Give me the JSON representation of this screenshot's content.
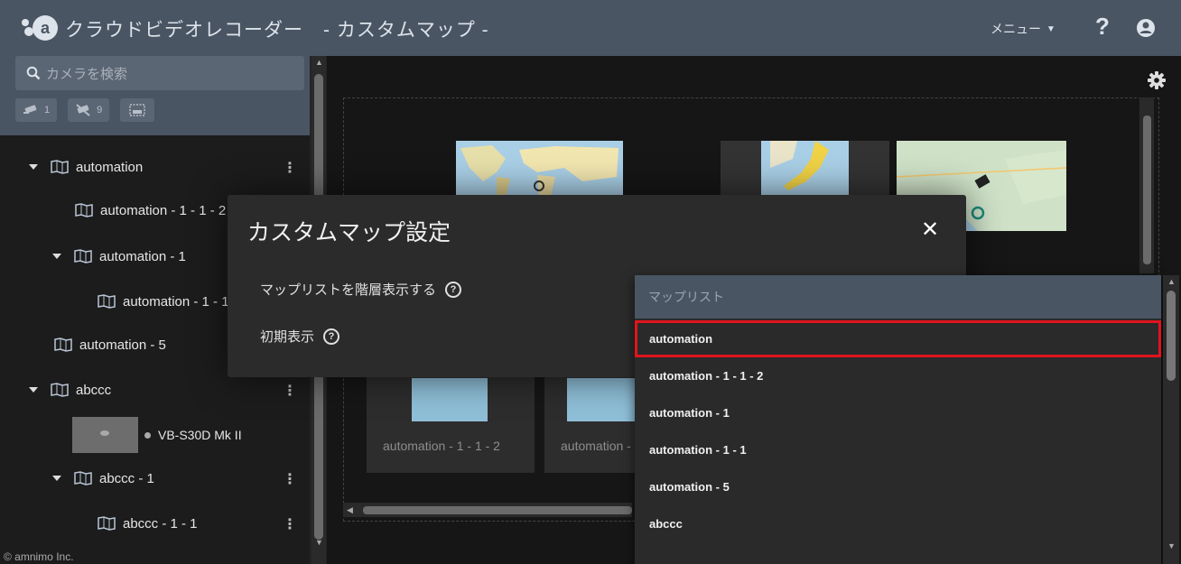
{
  "header": {
    "app_title": "クラウドビデオレコーダー　- カスタムマップ -",
    "menu_label": "メニュー",
    "help_label": "?"
  },
  "sidebar": {
    "search_placeholder": "カメラを検索",
    "filters": {
      "online_count": "1",
      "offline_count": "9"
    },
    "tree": [
      {
        "label": "automation",
        "level": 0,
        "expanded": true
      },
      {
        "label": "automation - 1 - 1 - 2",
        "level": 1
      },
      {
        "label": "automation - 1",
        "level": 1,
        "expanded": true
      },
      {
        "label": "automation - 1 - 1",
        "level": 2
      },
      {
        "label": "automation - 5",
        "level": 0
      },
      {
        "label": "abccc",
        "level": 0,
        "expanded": true
      },
      {
        "label": "VB-S30D Mk II",
        "level": 1,
        "type": "camera"
      },
      {
        "label": "abccc - 1",
        "level": 1,
        "expanded": true
      },
      {
        "label": "abccc - 1 - 1",
        "level": 2
      }
    ],
    "copyright": "© amnimo Inc."
  },
  "main": {
    "cards": [
      {
        "label": "automation - 1 - 1 - 2"
      },
      {
        "label": "automation -"
      }
    ]
  },
  "dialog": {
    "title": "カスタムマップ設定",
    "hierarchy_label": "マップリストを階層表示する",
    "initial_display_label": "初期表示"
  },
  "dropdown": {
    "header": "マップリスト",
    "items": [
      "automation",
      "automation - 1 - 1 - 2",
      "automation - 1",
      "automation - 1 - 1",
      "automation - 5",
      "abccc"
    ],
    "selected_index": 0
  },
  "colors": {
    "header_bg": "#4a5563",
    "highlight": "#e0141e",
    "sidebar_bg": "#1c1c1c"
  }
}
